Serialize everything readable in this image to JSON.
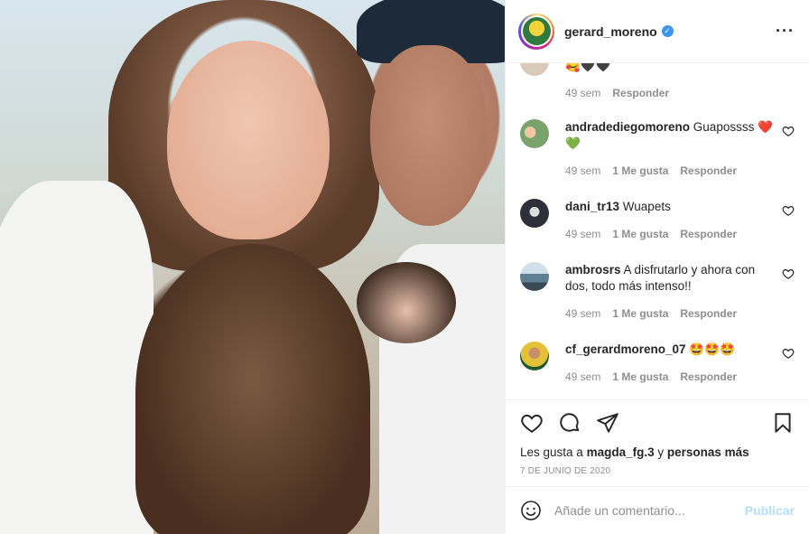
{
  "post": {
    "username": "gerard_moreno",
    "verified": true,
    "more_icon": "more-icon",
    "likes_prefix": "Les gusta a",
    "likes_user": "magda_fg.3",
    "likes_and": "y",
    "likes_rest": "personas más",
    "date": "7 DE JUNIO DE 2020"
  },
  "comments": [
    {
      "user": "",
      "text": "🥰🖤🖤",
      "time": "49 sem",
      "likes": "",
      "reply": "Responder",
      "avatar_color": "#d9c9b8"
    },
    {
      "user": "andradediegomoreno",
      "text": "Guapossss ❤️💚",
      "time": "49 sem",
      "likes": "1 Me gusta",
      "reply": "Responder",
      "avatar_color": "#7aa36b"
    },
    {
      "user": "dani_tr13",
      "text": "Wuapets",
      "time": "49 sem",
      "likes": "1 Me gusta",
      "reply": "Responder",
      "avatar_color": "#3a3a44"
    },
    {
      "user": "ambrosrs",
      "text": "A disfrutarlo y ahora con dos, todo más intenso!!",
      "time": "49 sem",
      "likes": "1 Me gusta",
      "reply": "Responder",
      "avatar_color": "#6c8aa0"
    },
    {
      "user": "cf_gerardmoreno_07",
      "text": "🤩🤩🤩",
      "time": "49 sem",
      "likes": "1 Me gusta",
      "reply": "Responder",
      "avatar_color": "#e3c23a"
    }
  ],
  "add_comment": {
    "placeholder": "Añade un comentario...",
    "publish": "Publicar"
  },
  "colors": {
    "verified": "#3897f0",
    "muted": "#8e8e8e",
    "publish_disabled": "#b2dffc"
  }
}
